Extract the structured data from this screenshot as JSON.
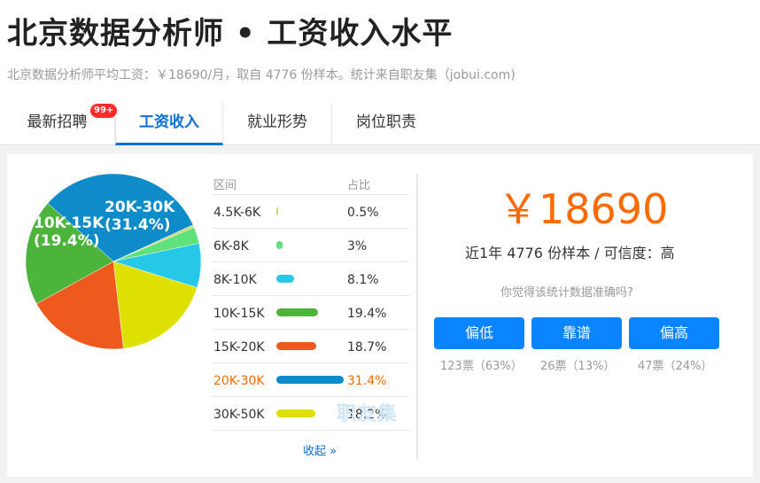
{
  "header": {
    "title": "北京数据分析师 • 工资收入水平",
    "subtitle": "北京数据分析师平均工资：￥18690/月，取自 4776 份样本。统计来自职友集（jobui.com)"
  },
  "tabs": [
    {
      "label": "最新招聘",
      "badge": "99+"
    },
    {
      "label": "工资收入",
      "active": true
    },
    {
      "label": "就业形势"
    },
    {
      "label": "岗位职责"
    }
  ],
  "table": {
    "col_range": "区间",
    "col_share": "占比",
    "rows": [
      {
        "range": "4.5K-6K",
        "share": "0.5%",
        "color": "#c8d96a"
      },
      {
        "range": "6K-8K",
        "share": "3%",
        "color": "#5ee07a"
      },
      {
        "range": "8K-10K",
        "share": "8.1%",
        "color": "#25c8e6"
      },
      {
        "range": "10K-15K",
        "share": "19.4%",
        "color": "#4cb43a"
      },
      {
        "range": "15K-20K",
        "share": "18.7%",
        "color": "#ee5a1e"
      },
      {
        "range": "20K-30K",
        "share": "31.4%",
        "color": "#0e8bc9",
        "highlight": true
      },
      {
        "range": "30K-50K",
        "share": "18.2%",
        "color": "#dde000"
      }
    ],
    "more_link": "收起 »",
    "watermark": "职友集"
  },
  "pie": {
    "labels": [
      {
        "range": "20K-30K",
        "share": "(31.4%)"
      },
      {
        "range": "10K-15K",
        "share": "(19.4%)"
      }
    ]
  },
  "chart_data": {
    "type": "pie",
    "categories": [
      "4.5K-6K",
      "6K-8K",
      "8K-10K",
      "10K-15K",
      "15K-20K",
      "20K-30K",
      "30K-50K"
    ],
    "values": [
      0.5,
      3,
      8.1,
      19.4,
      18.7,
      31.4,
      18.2
    ],
    "colors": [
      "#c8d96a",
      "#5ee07a",
      "#25c8e6",
      "#4cb43a",
      "#ee5a1e",
      "#0e8bc9",
      "#dde000"
    ]
  },
  "summary": {
    "salary": "￥18690",
    "meta": "近1年 4776 份样本 / 可信度：高",
    "question": "你觉得该统计数据准确吗?"
  },
  "votes": [
    {
      "label": "偏低",
      "count": "123票（63%）"
    },
    {
      "label": "靠谱",
      "count": "26票（13%）"
    },
    {
      "label": "偏高",
      "count": "47票（24%）"
    }
  ]
}
